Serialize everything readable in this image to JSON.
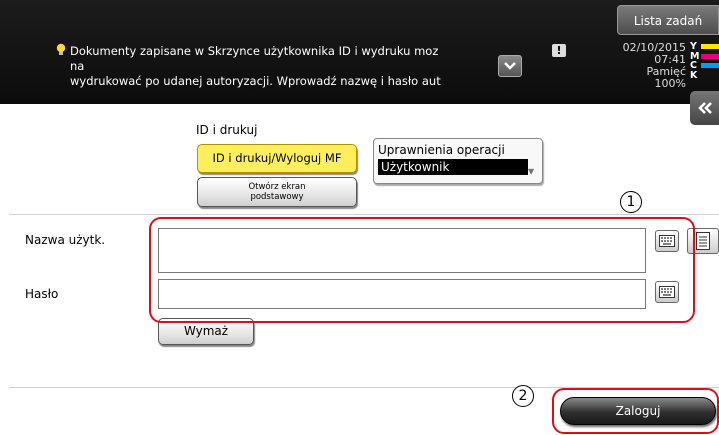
{
  "header": {
    "job_list_label": "Lista zadań",
    "message_lines": [
      "Dokumenty zapisane w Skrzynce użytkownika ID i wydruku moz",
      "na",
      "wydrukować po udanej autoryzacji. Wprowadź nazwę i hasło aut"
    ],
    "warning_glyph": "!",
    "date": "02/10/2015",
    "time": "07:41",
    "memory_label": "Pamięć",
    "memory_value": "100%",
    "toner": [
      {
        "letter": "Y",
        "color": "#ffe600"
      },
      {
        "letter": "M",
        "color": "#e6007e"
      },
      {
        "letter": "C",
        "color": "#00a0e9"
      },
      {
        "letter": "K",
        "color": "#111111"
      }
    ]
  },
  "auth_mode": {
    "section_label": "ID i drukuj",
    "selected_button": "ID i drukuj/Wyloguj MF",
    "home_button_line1": "Otwórz ekran",
    "home_button_line2": "podstawowy"
  },
  "permission": {
    "title": "Uprawnienia operacji",
    "value": "Użytkownik"
  },
  "form": {
    "username_label": "Nazwa użytk.",
    "username_value": "",
    "password_label": "Hasło",
    "password_value": "",
    "clear_button": "Wymaż",
    "login_button": "Zaloguj"
  },
  "callouts": [
    "1",
    "2"
  ],
  "colors": {
    "accent_red": "#d8101a",
    "selected_yellow": "#ffef5c"
  }
}
